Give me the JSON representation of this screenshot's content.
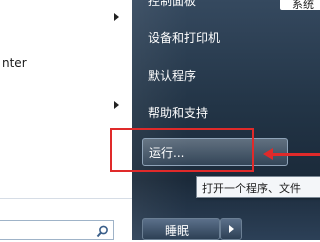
{
  "left": {
    "items": [
      {
        "label": "nter"
      }
    ],
    "search": {
      "placeholder": ""
    }
  },
  "right": {
    "top_partial": "控制面板",
    "items": [
      {
        "label": "设备和打印机"
      },
      {
        "label": "默认程序"
      },
      {
        "label": "帮助和支持"
      }
    ],
    "run_label": "运行...",
    "sleep_label": "睡眠",
    "corner_text": "系统"
  },
  "tooltip": {
    "text": "打开一个程序、文件"
  },
  "colors": {
    "annotation": "#e02a2a",
    "pane_dark": "#223446"
  }
}
